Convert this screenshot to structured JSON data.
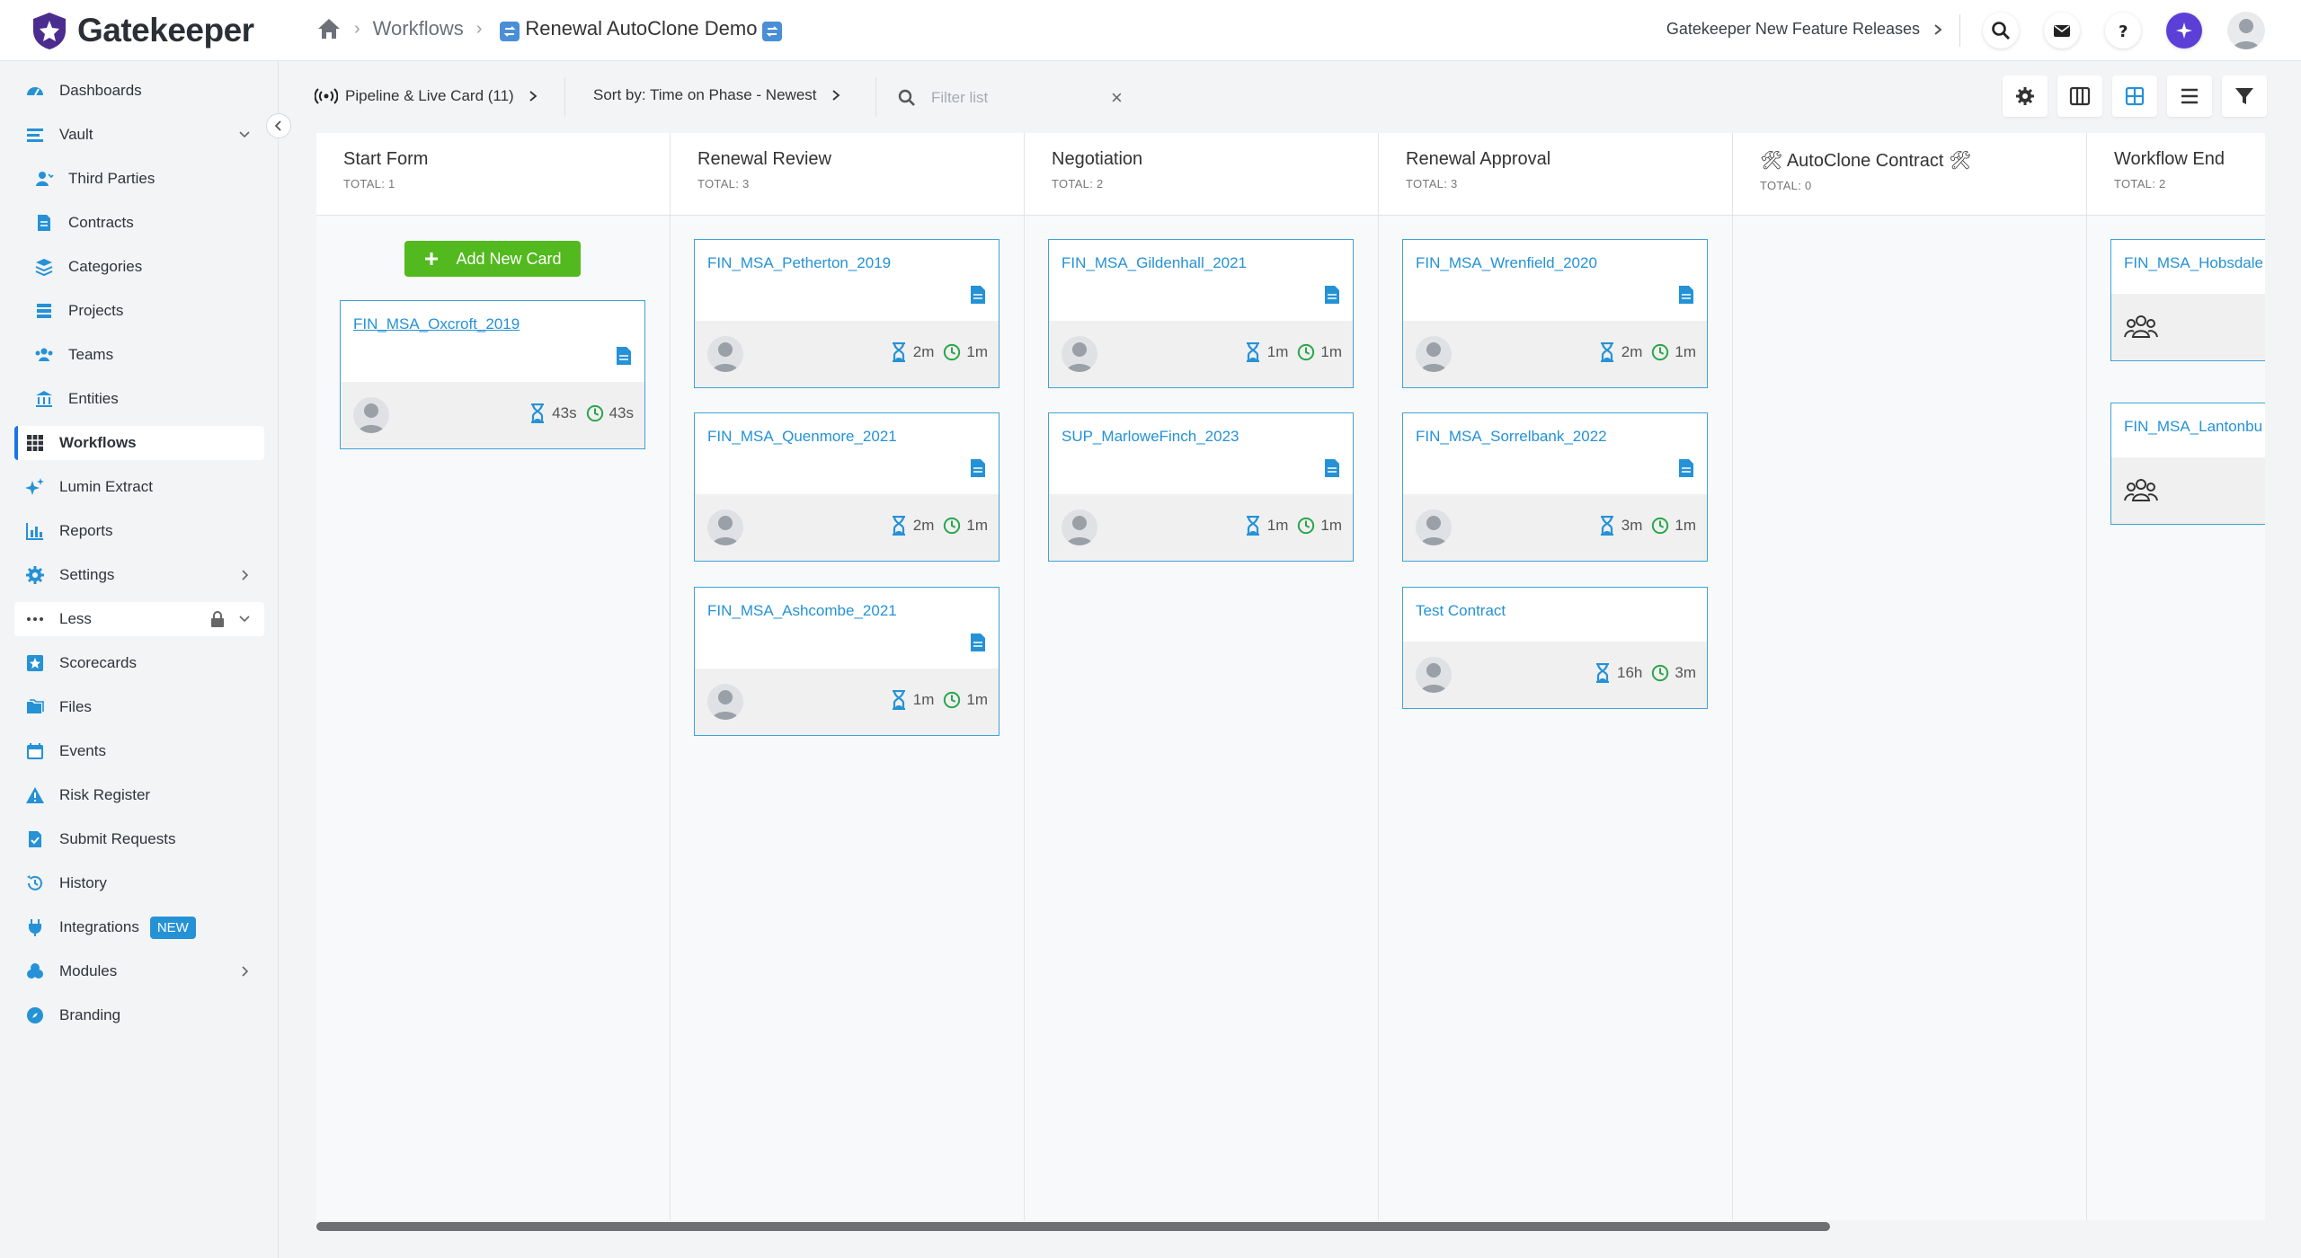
{
  "app": {
    "name": "Gatekeeper"
  },
  "breadcrumb": {
    "items": [
      "Workflows"
    ],
    "current": "Renewal AutoClone Demo"
  },
  "header": {
    "release_link": "Gatekeeper New Feature Releases"
  },
  "sidebar": {
    "items": [
      {
        "label": "Dashboards",
        "icon": "gauge-icon"
      },
      {
        "label": "Vault",
        "icon": "vault-icon"
      },
      {
        "label": "Third Parties",
        "icon": "user-icon"
      },
      {
        "label": "Contracts",
        "icon": "document-icon"
      },
      {
        "label": "Categories",
        "icon": "layers-icon"
      },
      {
        "label": "Projects",
        "icon": "list-icon"
      },
      {
        "label": "Teams",
        "icon": "users-icon"
      },
      {
        "label": "Entities",
        "icon": "building-icon"
      },
      {
        "label": "Workflows",
        "icon": "table-icon"
      },
      {
        "label": "Lumin Extract",
        "icon": "sparkle-icon"
      },
      {
        "label": "Reports",
        "icon": "chart-icon"
      },
      {
        "label": "Settings",
        "icon": "gear-icon"
      },
      {
        "label": "Less",
        "icon": "dots-icon"
      },
      {
        "label": "Scorecards",
        "icon": "star-icon"
      },
      {
        "label": "Files",
        "icon": "files-icon"
      },
      {
        "label": "Events",
        "icon": "calendar-icon"
      },
      {
        "label": "Risk Register",
        "icon": "warning-icon"
      },
      {
        "label": "Submit Requests",
        "icon": "check-doc-icon"
      },
      {
        "label": "History",
        "icon": "history-icon"
      },
      {
        "label": "Integrations",
        "icon": "plug-icon",
        "badge": "NEW"
      },
      {
        "label": "Modules",
        "icon": "modules-icon"
      },
      {
        "label": "Branding",
        "icon": "compass-icon"
      }
    ]
  },
  "toolbar": {
    "pipeline_label": "Pipeline & Live Card (11)",
    "sort_label": "Sort by: Time on Phase - Newest",
    "filter_placeholder": "Filter list"
  },
  "board": {
    "add_card_label": "Add New Card",
    "columns": [
      {
        "title": "Start Form",
        "total": "TOTAL: 1",
        "cards": [
          {
            "title": "FIN_MSA_Oxcroft_2019",
            "t1": "43s",
            "t2": "43s"
          }
        ]
      },
      {
        "title": "Renewal Review",
        "total": "TOTAL: 3",
        "cards": [
          {
            "title": "FIN_MSA_Petherton_2019",
            "t1": "2m",
            "t2": "1m"
          },
          {
            "title": "FIN_MSA_Quenmore_2021",
            "t1": "2m",
            "t2": "1m"
          },
          {
            "title": "FIN_MSA_Ashcombe_2021",
            "t1": "1m",
            "t2": "1m"
          }
        ]
      },
      {
        "title": "Negotiation",
        "total": "TOTAL: 2",
        "cards": [
          {
            "title": "FIN_MSA_Gildenhall_2021",
            "t1": "1m",
            "t2": "1m"
          },
          {
            "title": "SUP_MarloweFinch_2023",
            "t1": "1m",
            "t2": "1m"
          }
        ]
      },
      {
        "title": "Renewal Approval",
        "total": "TOTAL: 3",
        "cards": [
          {
            "title": "FIN_MSA_Wrenfield_2020",
            "t1": "2m",
            "t2": "1m"
          },
          {
            "title": "FIN_MSA_Sorrelbank_2022",
            "t1": "3m",
            "t2": "1m"
          },
          {
            "title": "Test Contract",
            "t1": "16h",
            "t2": "3m"
          }
        ]
      },
      {
        "title": "🛠 AutoClone Contract 🛠",
        "total": "TOTAL: 0",
        "cards": []
      },
      {
        "title": "Workflow End",
        "total": "TOTAL: 2",
        "cards": [
          {
            "title": "FIN_MSA_Hobsdale"
          },
          {
            "title": "FIN_MSA_Lantonbu"
          }
        ]
      }
    ]
  },
  "colors": {
    "accent": "#2592d6",
    "add_button": "#52b91e",
    "card_border": "#3fa3d7",
    "timer_green": "#2aa64a"
  }
}
